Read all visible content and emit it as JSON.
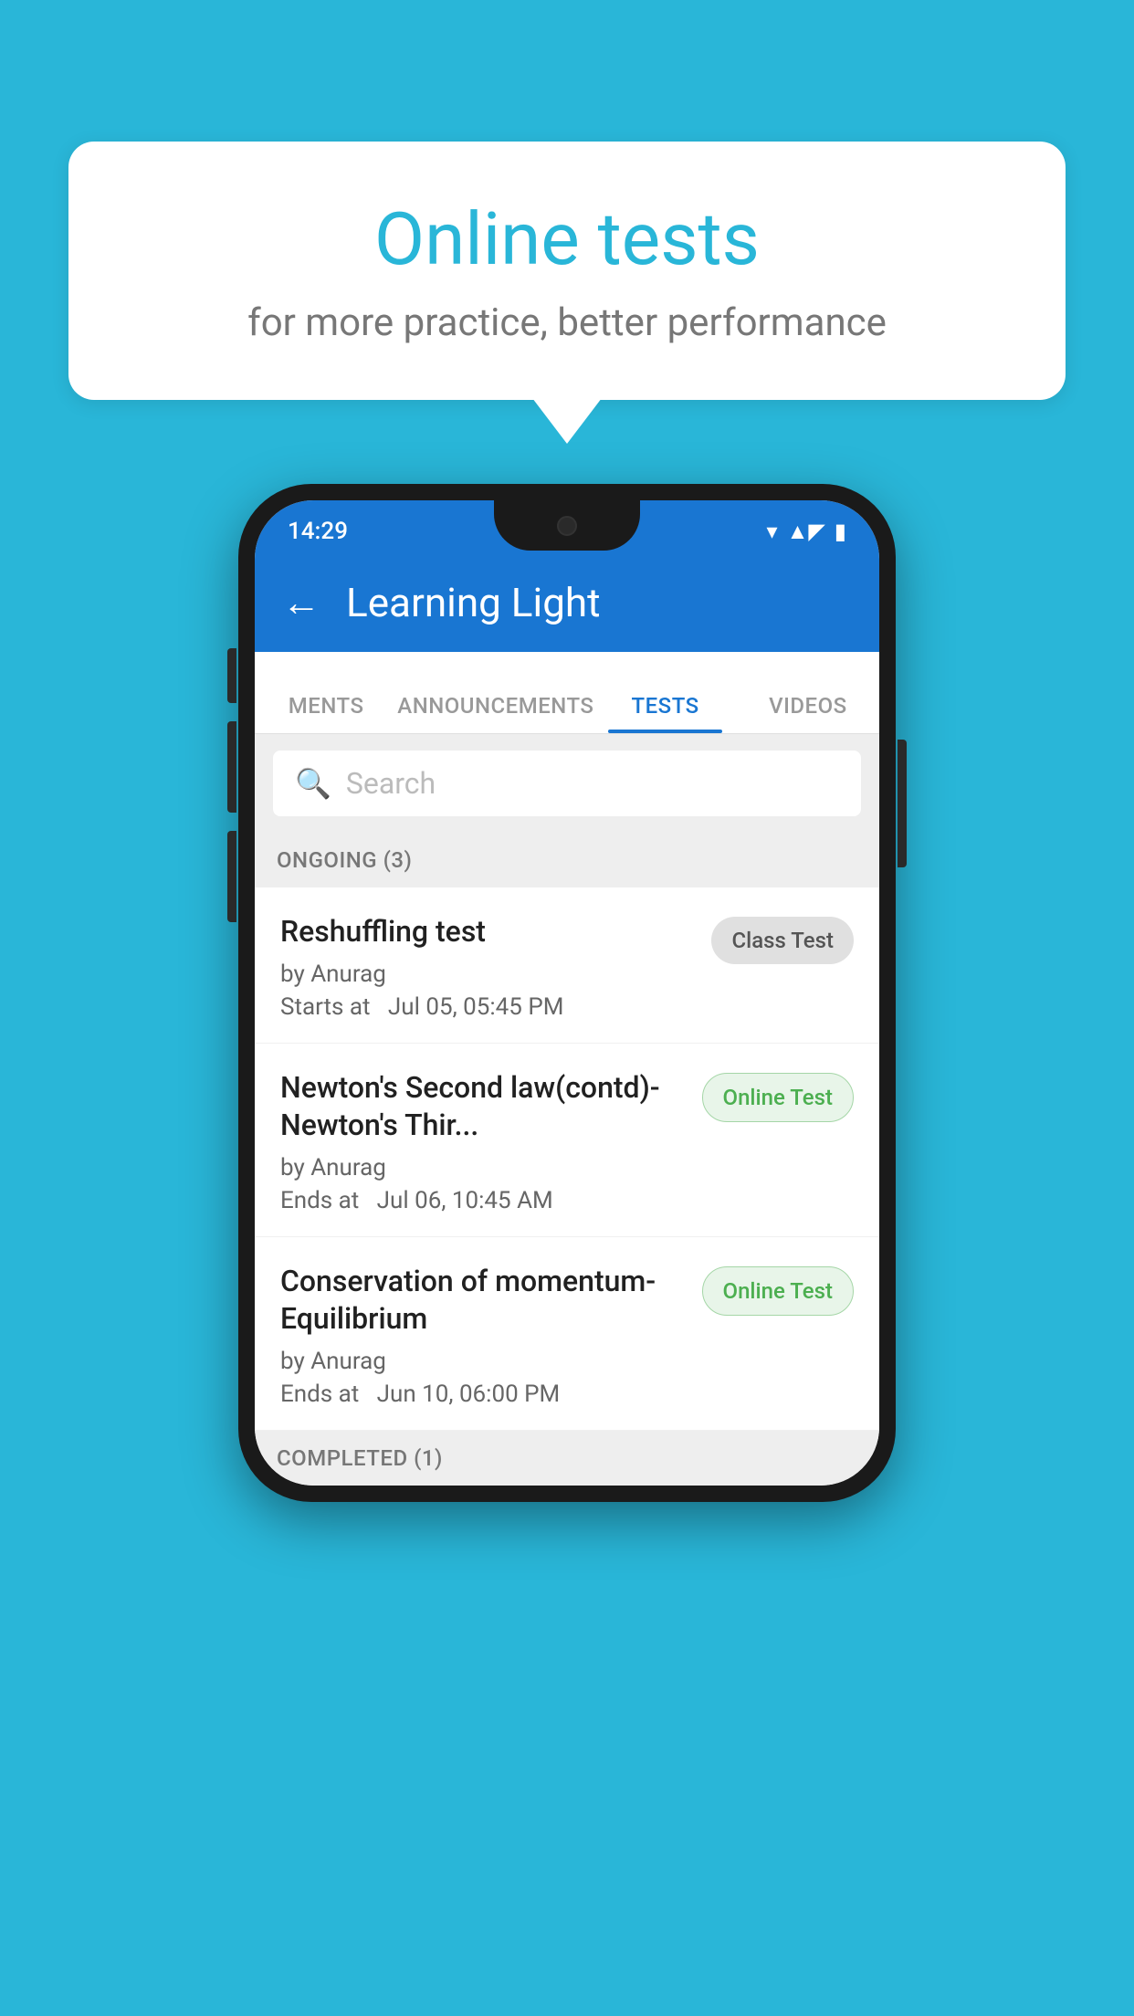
{
  "background_color": "#29B6D8",
  "speech_bubble": {
    "title": "Online tests",
    "subtitle": "for more practice, better performance"
  },
  "phone": {
    "status_bar": {
      "time": "14:29",
      "icons": [
        "wifi",
        "signal",
        "battery"
      ]
    },
    "app_bar": {
      "back_label": "←",
      "title": "Learning Light"
    },
    "tabs": [
      {
        "label": "MENTS",
        "active": false
      },
      {
        "label": "ANNOUNCEMENTS",
        "active": false
      },
      {
        "label": "TESTS",
        "active": true
      },
      {
        "label": "VIDEOS",
        "active": false
      }
    ],
    "search": {
      "placeholder": "Search",
      "icon": "🔍"
    },
    "ongoing_section": {
      "label": "ONGOING (3)",
      "items": [
        {
          "name": "Reshuffling test",
          "author": "by Anurag",
          "date": "Starts at  Jul 05, 05:45 PM",
          "badge": "Class Test",
          "badge_type": "class"
        },
        {
          "name": "Newton's Second law(contd)-Newton's Thir...",
          "author": "by Anurag",
          "date": "Ends at  Jul 06, 10:45 AM",
          "badge": "Online Test",
          "badge_type": "online"
        },
        {
          "name": "Conservation of momentum-Equilibrium",
          "author": "by Anurag",
          "date": "Ends at  Jun 10, 06:00 PM",
          "badge": "Online Test",
          "badge_type": "online"
        }
      ]
    },
    "completed_section": {
      "label": "COMPLETED (1)"
    }
  }
}
